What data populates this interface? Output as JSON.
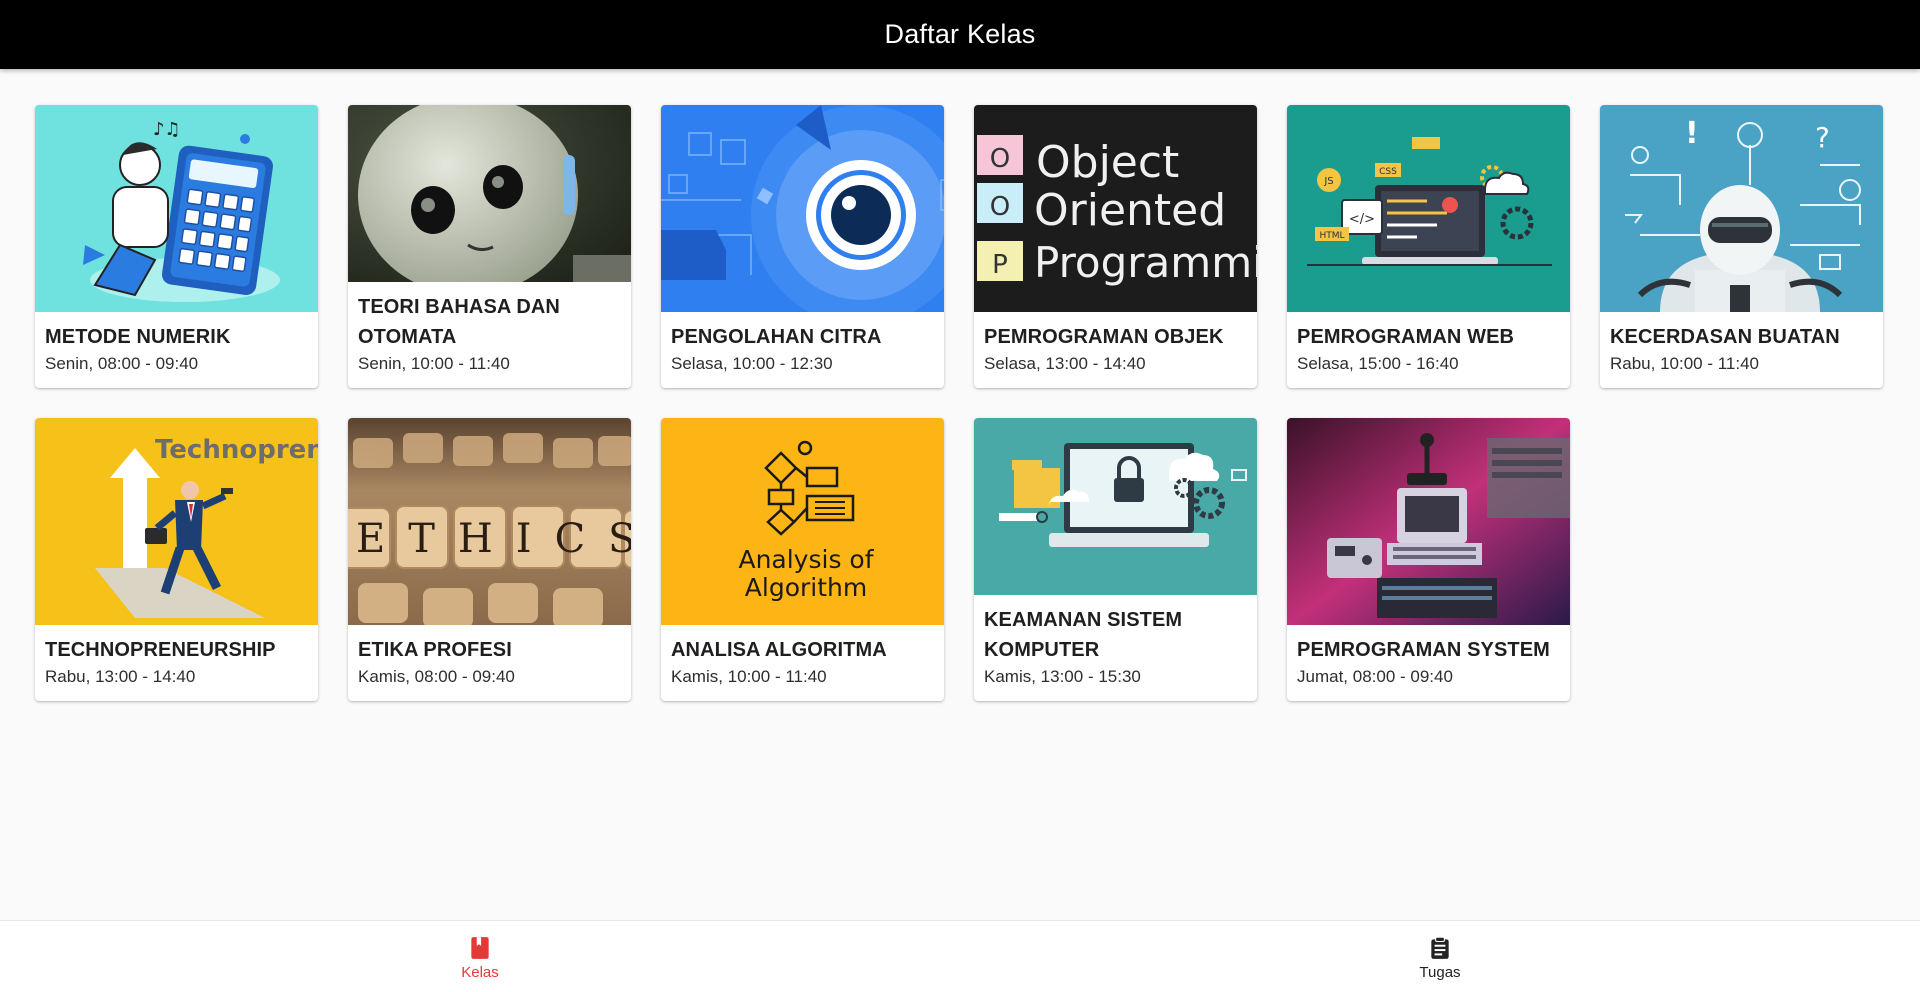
{
  "appbar": {
    "title": "Daftar Kelas"
  },
  "classes": [
    {
      "title": "METODE NUMERIK",
      "schedule": "Senin, 08:00 - 09:40",
      "image": "calculator-illustration"
    },
    {
      "title": "TEORI BAHASA DAN OTOMATA",
      "schedule": "Senin, 10:00 - 11:40",
      "image": "robot-photo"
    },
    {
      "title": "PENGOLAHAN CITRA",
      "schedule": "Selasa, 10:00 - 12:30",
      "image": "eye-tech-illustration"
    },
    {
      "title": "PEMROGRAMAN OBJEK",
      "schedule": "Selasa, 13:00 - 14:40",
      "image": "oop-chalkboard"
    },
    {
      "title": "PEMROGRAMAN WEB",
      "schedule": "Selasa, 15:00 - 16:40",
      "image": "web-dev-illustration"
    },
    {
      "title": "KECERDASAN BUATAN",
      "schedule": "Rabu, 10:00 - 11:40",
      "image": "ai-robot-illustration"
    },
    {
      "title": "TECHNOPRENEURSHIP",
      "schedule": "Rabu, 13:00 - 14:40",
      "image": "businessman-arrow-illustration"
    },
    {
      "title": "ETIKA PROFESI",
      "schedule": "Kamis, 08:00 - 09:40",
      "image": "ethics-blocks-photo"
    },
    {
      "title": "ANALISA ALGORITMA",
      "schedule": "Kamis, 10:00 - 11:40",
      "image": "flowchart-illustration"
    },
    {
      "title": "KEAMANAN SISTEM KOMPUTER",
      "schedule": "Kamis, 13:00 - 15:30",
      "image": "laptop-lock-illustration"
    },
    {
      "title": "PEMROGRAMAN SYSTEM",
      "schedule": "Jumat, 08:00 - 09:40",
      "image": "retro-computers-photo"
    }
  ],
  "images": {
    "oop": {
      "letters": [
        "O",
        "O",
        "P"
      ],
      "line1": "Object",
      "line2": "Oriented",
      "line3": "Programming"
    },
    "technopreneur": {
      "text": "Technopreneur"
    },
    "ethics": {
      "text": "ETHICS"
    },
    "algorithm": {
      "line1": "Analysis of",
      "line2": "Algorithm"
    },
    "web": {
      "js": "JS",
      "css": "CSS",
      "html": "HTML"
    }
  },
  "bottom_nav": {
    "items": [
      {
        "label": "Kelas",
        "icon": "book-icon",
        "active": true
      },
      {
        "label": "Tugas",
        "icon": "clipboard-icon",
        "active": false
      }
    ]
  },
  "colors": {
    "accent": "#e53935",
    "appbar": "#000000",
    "background": "#fafafa"
  }
}
